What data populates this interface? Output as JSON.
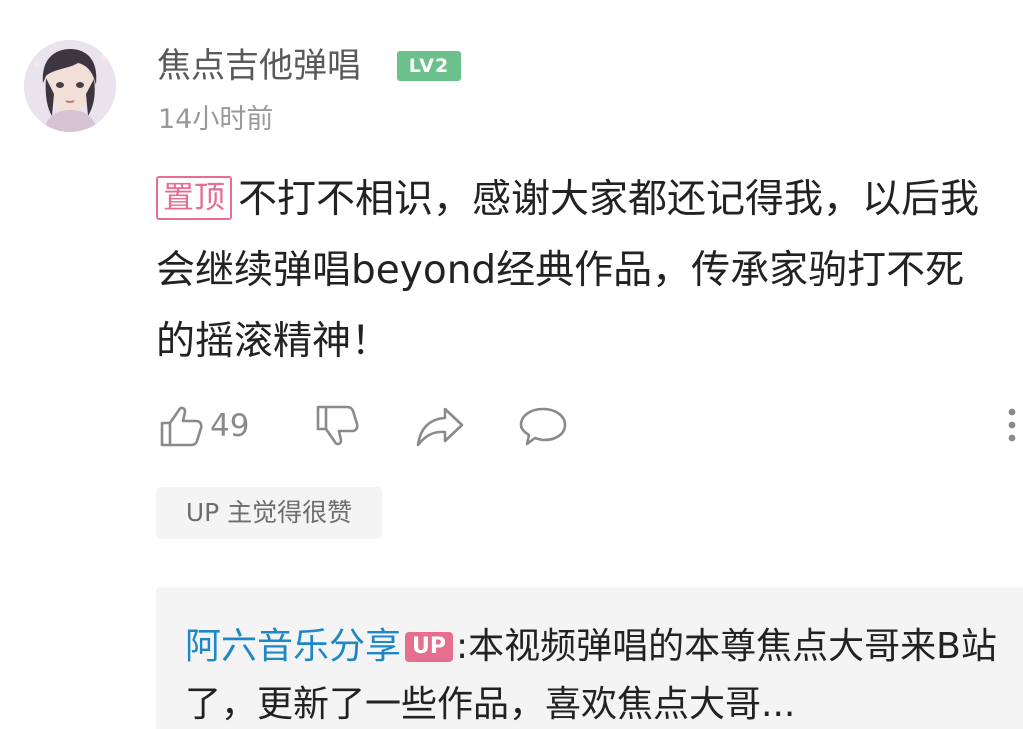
{
  "comment": {
    "author": {
      "name": "焦点吉他弹唱",
      "level": "LV2",
      "avatar": "avatar-portrait"
    },
    "timestamp": "14小时前",
    "pin_label": "置顶",
    "text": "不打不相识，感谢大家都还记得我，以后我会继续弹唱beyond经典作品，传承家驹打不死的摇滚精神！",
    "actions": {
      "like_count": "49",
      "like_icon": "thumbs-up-icon",
      "dislike_icon": "thumbs-down-icon",
      "share_icon": "share-icon",
      "reply_icon": "comment-icon",
      "more_icon": "more-vertical-icon"
    },
    "up_liked_tag": "UP 主觉得很赞"
  },
  "reply_preview": {
    "author": "阿六音乐分享",
    "author_badge": "UP",
    "separator": ":",
    "text": "本视频弹唱的本尊焦点大哥来B站了，更新了一些作品，喜欢焦点大哥..."
  },
  "colors": {
    "level_badge": "#6cc08b",
    "pin_badge": "#e66e8f",
    "up_badge": "#e66e8f",
    "link_blue": "#1e88c7",
    "muted_gray": "#8a8a8a",
    "tag_background": "#f4f4f4"
  }
}
